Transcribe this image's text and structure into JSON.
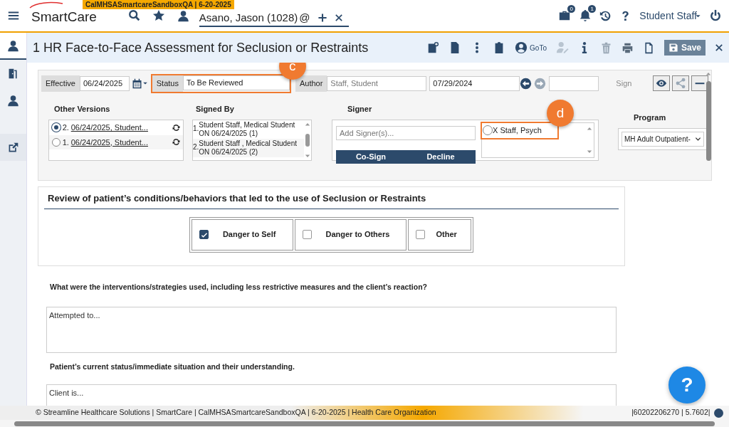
{
  "environment_tag": "CalMHSASmartcareSandboxQA | 6-20-2025",
  "app_name": "SmartCare",
  "client": {
    "name": "Asano, Jason (1028)",
    "at_sign": "@"
  },
  "header_badges": [
    {
      "kind": "briefcase",
      "badge": "0"
    },
    {
      "kind": "bell",
      "badge": "1"
    }
  ],
  "user_menu": "Student Staff",
  "sidebar": {
    "items": [
      {
        "kind": "person",
        "selected": true
      },
      {
        "kind": "door",
        "selected": false
      },
      {
        "kind": "person",
        "selected": false
      },
      {
        "kind": "external",
        "selected": false
      }
    ]
  },
  "document": {
    "title": "1 HR Face-to-Face Assessment for Seclusion or Restraints",
    "goto": "GoTo",
    "save": {
      "label": "Save",
      "disabled": true
    }
  },
  "header_fields": {
    "effective_label": "Effective",
    "effective": "06/24/2025",
    "status_label": "Status",
    "status": "To Be Reviewed",
    "status_callout": "c",
    "author_label": "Author",
    "author": "Staff, Student",
    "date": "07/29/2024",
    "sign": {
      "label": "Sign",
      "disabled": true
    }
  },
  "other_versions": {
    "title": "Other Versions",
    "items": [
      {
        "number": "2.",
        "text": "06/24/2025, Student...",
        "selected": true
      },
      {
        "number": "1.",
        "text": "06/24/2025, Student...",
        "selected": false
      }
    ]
  },
  "signed_by": {
    "title": "Signed By",
    "items": [
      {
        "number": "1.",
        "text": "Student Staff, Medical Student ON 06/24/2025 (1)"
      },
      {
        "number": "2.",
        "text": "Student Staff , Medical Student ON 06/24/2025 (2)"
      }
    ]
  },
  "signer": {
    "title": "Signer",
    "placeholder": "Add Signer(s)...",
    "buttons": [
      "Co-Sign",
      "Decline"
    ],
    "list": [
      {
        "text": "X Staff, Psych",
        "selected": false,
        "callout": "d"
      }
    ]
  },
  "program": {
    "title": "Program",
    "value": "MH Adult Outpatient-"
  },
  "section": {
    "title": "Review of patient’s conditions/behaviors that led to the use of Seclusion or Restraints",
    "options": [
      {
        "label": "Danger to Self",
        "checked": true
      },
      {
        "label": "Danger to Others",
        "checked": false
      },
      {
        "label": "Other",
        "checked": false
      }
    ]
  },
  "questions": [
    {
      "label": "What were the interventions/strategies used, including less restrictive measures and the client’s reaction?",
      "value": "Attempted to..."
    },
    {
      "label": "Patient’s current status/immediate situation and their understanding.",
      "value": "Client is..."
    }
  ],
  "help_button": "?",
  "footer": {
    "text": "© Streamline Healthcare Solutions | SmartCare | CalMHSASmartcareSandboxQA | 6-20-2025 | Health Care Organization",
    "version": "|60202206270 | 5.7602|"
  }
}
